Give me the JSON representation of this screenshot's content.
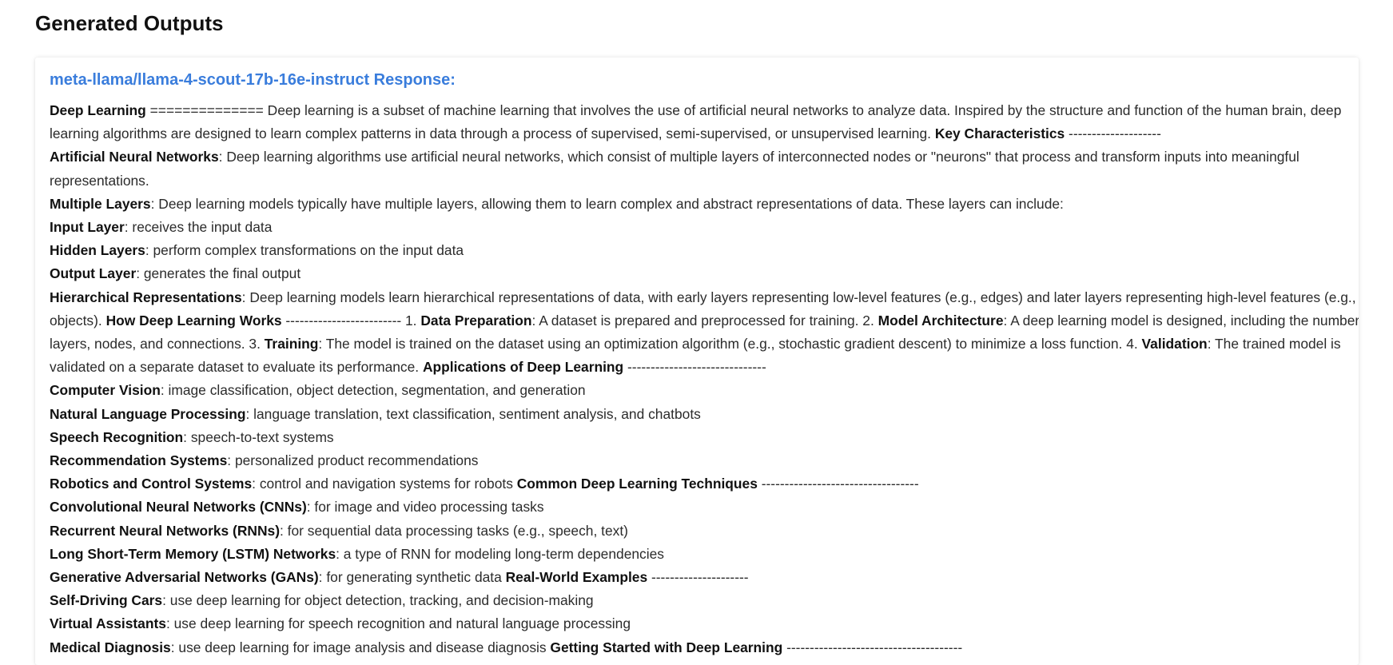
{
  "page": {
    "title": "Generated Outputs"
  },
  "theme": {
    "accent": "#3a7ddc",
    "text": "#2b2b2b",
    "bold": "#111111"
  },
  "response": {
    "title": "meta-llama/llama-4-scout-17b-16e-instruct Response:",
    "lines": [
      [
        {
          "b": "Deep Learning"
        },
        {
          "t": " ============== Deep learning is a subset of machine learning that involves the use of artificial neural networks to analyze data. Inspired by the structure and function of the human brain, deep learning algorithms are designed to learn complex patterns in data through a process of supervised, semi-supervised, or unsupervised learning. "
        },
        {
          "b": "Key Characteristics"
        },
        {
          "t": " --------------------"
        }
      ],
      [
        {
          "b": "Artificial Neural Networks"
        },
        {
          "t": ": Deep learning algorithms use artificial neural networks, which consist of multiple layers of interconnected nodes or \"neurons\" that process and transform inputs into meaningful representations."
        }
      ],
      [
        {
          "b": "Multiple Layers"
        },
        {
          "t": ": Deep learning models typically have multiple layers, allowing them to learn complex and abstract representations of data. These layers can include:"
        }
      ],
      [
        {
          "b": "Input Layer"
        },
        {
          "t": ": receives the input data"
        }
      ],
      [
        {
          "b": "Hidden Layers"
        },
        {
          "t": ": perform complex transformations on the input data"
        }
      ],
      [
        {
          "b": "Output Layer"
        },
        {
          "t": ": generates the final output"
        }
      ],
      [
        {
          "b": "Hierarchical Representations"
        },
        {
          "t": ": Deep learning models learn hierarchical representations of data, with early layers representing low-level features (e.g., edges) and later layers representing high-level features (e.g., objects). "
        },
        {
          "b": "How Deep Learning Works"
        },
        {
          "t": " ------------------------- 1. "
        },
        {
          "b": "Data Preparation"
        },
        {
          "t": ": A dataset is prepared and preprocessed for training. 2. "
        },
        {
          "b": "Model Architecture"
        },
        {
          "t": ": A deep learning model is designed, including the number of layers, nodes, and connections. 3. "
        },
        {
          "b": "Training"
        },
        {
          "t": ": The model is trained on the dataset using an optimization algorithm (e.g., stochastic gradient descent) to minimize a loss function. 4. "
        },
        {
          "b": "Validation"
        },
        {
          "t": ": The trained model is validated on a separate dataset to evaluate its performance. "
        },
        {
          "b": "Applications of Deep Learning"
        },
        {
          "t": " ------------------------------"
        }
      ],
      [
        {
          "b": "Computer Vision"
        },
        {
          "t": ": image classification, object detection, segmentation, and generation"
        }
      ],
      [
        {
          "b": "Natural Language Processing"
        },
        {
          "t": ": language translation, text classification, sentiment analysis, and chatbots"
        }
      ],
      [
        {
          "b": "Speech Recognition"
        },
        {
          "t": ": speech-to-text systems"
        }
      ],
      [
        {
          "b": "Recommendation Systems"
        },
        {
          "t": ": personalized product recommendations"
        }
      ],
      [
        {
          "b": "Robotics and Control Systems"
        },
        {
          "t": ": control and navigation systems for robots "
        },
        {
          "b": "Common Deep Learning Techniques"
        },
        {
          "t": " ----------------------------------"
        }
      ],
      [
        {
          "b": "Convolutional Neural Networks (CNNs)"
        },
        {
          "t": ": for image and video processing tasks"
        }
      ],
      [
        {
          "b": "Recurrent Neural Networks (RNNs)"
        },
        {
          "t": ": for sequential data processing tasks (e.g., speech, text)"
        }
      ],
      [
        {
          "b": "Long Short-Term Memory (LSTM) Networks"
        },
        {
          "t": ": a type of RNN for modeling long-term dependencies"
        }
      ],
      [
        {
          "b": "Generative Adversarial Networks (GANs)"
        },
        {
          "t": ": for generating synthetic data "
        },
        {
          "b": "Real-World Examples"
        },
        {
          "t": " ---------------------"
        }
      ],
      [
        {
          "b": "Self-Driving Cars"
        },
        {
          "t": ": use deep learning for object detection, tracking, and decision-making"
        }
      ],
      [
        {
          "b": "Virtual Assistants"
        },
        {
          "t": ": use deep learning for speech recognition and natural language processing"
        }
      ],
      [
        {
          "b": "Medical Diagnosis"
        },
        {
          "t": ": use deep learning for image analysis and disease diagnosis "
        },
        {
          "b": "Getting Started with Deep Learning"
        },
        {
          "t": " --------------------------------------"
        }
      ]
    ]
  }
}
